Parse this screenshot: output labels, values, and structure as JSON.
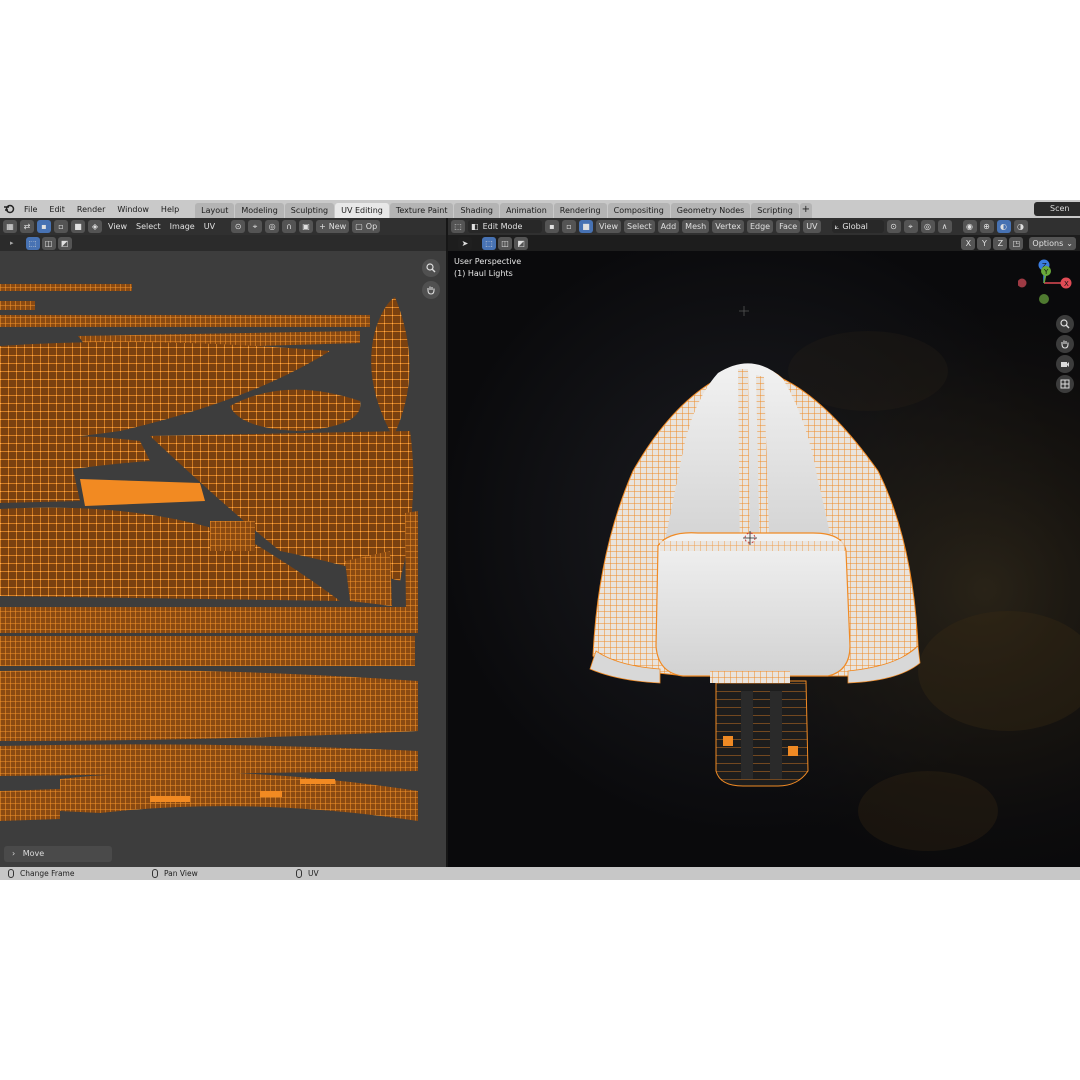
{
  "menu": [
    "File",
    "Edit",
    "Render",
    "Window",
    "Help"
  ],
  "workspaces": [
    "Layout",
    "Modeling",
    "Sculpting",
    "UV Editing",
    "Texture Paint",
    "Shading",
    "Animation",
    "Rendering",
    "Compositing",
    "Geometry Nodes",
    "Scripting"
  ],
  "active_workspace": "UV Editing",
  "scene_label": "Scen",
  "uv_editor": {
    "header_items": [
      "View",
      "Select",
      "Image",
      "UV"
    ],
    "new_label": "New",
    "open_label": "Op",
    "last_operator": "Move"
  },
  "viewport": {
    "mode": "Edit Mode",
    "header_items": [
      "View",
      "Select",
      "Add",
      "Mesh",
      "Vertex",
      "Edge",
      "Face",
      "UV"
    ],
    "orientation": "Global",
    "axes": [
      "X",
      "Y",
      "Z"
    ],
    "options_label": "Options",
    "perspective_label": "User Perspective",
    "object_label": "(1) Haul Lights",
    "gizmo_axes": [
      "X",
      "Y",
      "Z"
    ]
  },
  "status_bar": {
    "left": "Change Frame",
    "middle": "Pan View",
    "right": "UV"
  },
  "colors": {
    "uv_mesh": "#f08a24",
    "uv_background": "#3d3d3d",
    "viewport_bg": "#0d0d0f",
    "active_blue": "#4772b3",
    "hull_white": "#e6e6e6"
  }
}
